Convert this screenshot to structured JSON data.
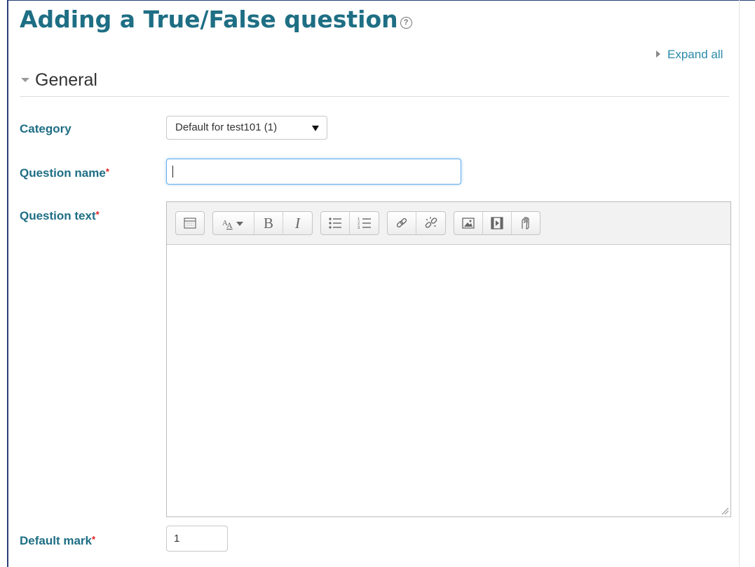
{
  "page": {
    "title": "Adding a True/False question",
    "help_icon": "help-circle-icon",
    "expand_all_label": "Expand all"
  },
  "section": {
    "title": "General"
  },
  "fields": {
    "category": {
      "label": "Category",
      "selected": "Default for test101 (1)"
    },
    "question_name": {
      "label": "Question name",
      "required_mark": "*",
      "value": ""
    },
    "question_text": {
      "label": "Question text",
      "required_mark": "*",
      "value": ""
    },
    "default_mark": {
      "label": "Default mark",
      "required_mark": "*",
      "value": "1"
    }
  },
  "editor_toolbar": {
    "groups": [
      [
        "toolbar-toggle-icon"
      ],
      [
        "text-style-icon",
        "bold-icon",
        "italic-icon"
      ],
      [
        "unordered-list-icon",
        "ordered-list-icon"
      ],
      [
        "link-icon",
        "unlink-icon"
      ],
      [
        "image-icon",
        "media-icon",
        "file-manage-icon"
      ]
    ],
    "bold_glyph": "B",
    "italic_glyph": "I"
  },
  "colors": {
    "title": "#1e6e84",
    "link": "#2a8aa8",
    "label": "#1e6e84",
    "required": "#e02020",
    "focus_border": "#66afe9"
  }
}
